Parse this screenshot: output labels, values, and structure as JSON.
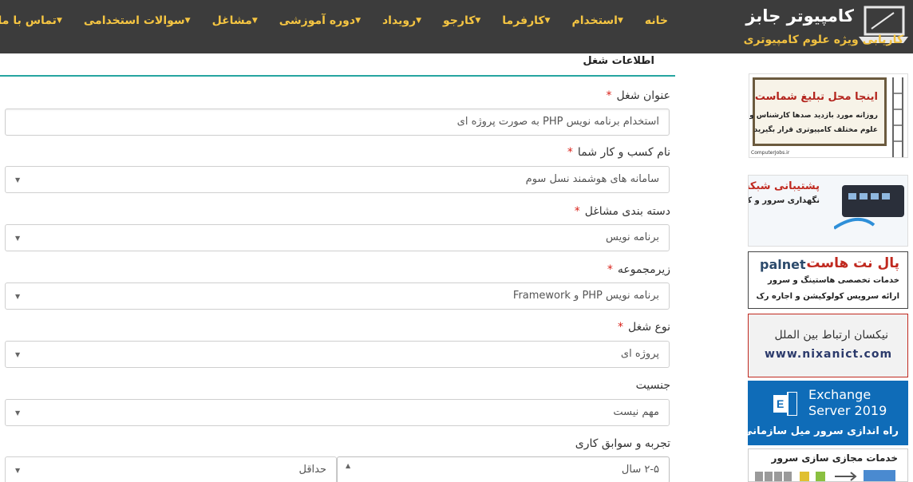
{
  "brand": {
    "title": "کامپیوتر جابز",
    "subtitle": "کاریابی ویژه علوم کامپیوتری"
  },
  "nav": [
    {
      "label": "خانه",
      "has_dropdown": false
    },
    {
      "label": "استخدام",
      "has_dropdown": true
    },
    {
      "label": "کارفرما",
      "has_dropdown": true
    },
    {
      "label": "کارجو",
      "has_dropdown": true
    },
    {
      "label": "رویداد",
      "has_dropdown": true
    },
    {
      "label": "دوره آموزشی",
      "has_dropdown": true
    },
    {
      "label": "مشاغل",
      "has_dropdown": true
    },
    {
      "label": "سوالات استخدامی",
      "has_dropdown": true
    },
    {
      "label": "تماس با ما",
      "has_dropdown": true
    }
  ],
  "form": {
    "section_title": "اطلاعات شغل",
    "fields": {
      "job_title": {
        "label": "عنوان شغل",
        "required": "*",
        "value": "استخدام برنامه نویس PHP به صورت پروژه ای"
      },
      "business_name": {
        "label": "نام کسب و کار شما",
        "required": "*",
        "value": "سامانه های هوشمند نسل سوم"
      },
      "job_category": {
        "label": "دسته بندی مشاغل",
        "required": "*",
        "value": "برنامه نویس"
      },
      "subcategory": {
        "label": "زیرمجموعه",
        "required": "*",
        "value": "برنامه نویس PHP و Framework"
      },
      "job_type": {
        "label": "نوع شغل",
        "required": "*",
        "value": "پروژه ای"
      },
      "gender": {
        "label": "جنسیت",
        "value": "مهم نیست"
      },
      "experience": {
        "label": "تجربه و سوابق کاری",
        "value_years": "۲-۵ سال",
        "value_min": "حداقل"
      }
    }
  },
  "ads": {
    "ad1": {
      "line1": "اینجا محل تبلیغ شماست",
      "line2": "روزانه مورد بازدید صدها کارشناس و مدیر",
      "line3": "علوم مختلف کامپیوتری قرار بگیرید",
      "site": "ComputerJobs.ir"
    },
    "ad2": {
      "line1": "پشتیبانی شبکه",
      "line2": "نگهداری سرور و کامپیوتر"
    },
    "ad3": {
      "brand": "palnet",
      "line1": "پال نت هاست",
      "line2": "خدمات تخصصی هاستینگ و سرور",
      "line3": "ارائه سرویس کولوکیشن و اجاره رک"
    },
    "ad4": {
      "line1": "نیکسان ارتباط بین الملل",
      "line2": "www.nixanict.com"
    },
    "ad5": {
      "line1": "Exchange",
      "line2": "Server 2019",
      "line3": "راه اندازی سرور میل سازمانی"
    },
    "ad6": {
      "line1": "خدمات مجازی سازی سرور"
    }
  },
  "colors": {
    "header_bg": "#3c3c3c",
    "nav_text": "#f5c542",
    "accent_line": "#26a5a0",
    "required": "#d9221a"
  }
}
